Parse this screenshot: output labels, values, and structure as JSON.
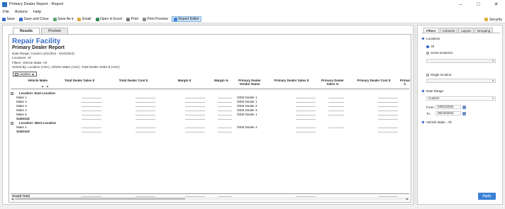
{
  "window": {
    "title": "Primary Dealer Report - Report"
  },
  "menu": [
    "File",
    "Actions",
    "Help"
  ],
  "toolbar": {
    "save": "Save",
    "save_close": "Save and Close",
    "save_as": "Save As",
    "email": "Email",
    "open_excel": "Open in Excel",
    "print": "Print",
    "print_preview": "Print Preview",
    "report_editor": "Report Editor",
    "security": "Security"
  },
  "tabs": {
    "results": "Results",
    "preview": "Preview"
  },
  "report": {
    "company": "Repair Facility",
    "title": "Primary Dealer Report",
    "date_range": "Date Range: Custom (4/1/2024 - 5/10/2024)",
    "locations": "Locations: All",
    "filters": "Filters: Vehicle Make: All",
    "sorted_by": "Sorted By: Location (ASC), Vehicle Make (ASC), Total Dealer Sales $ (ASC)",
    "group_button": "Location"
  },
  "columns": {
    "vehicle_make": "Vehicle Make",
    "total_dealer_sales": "Total Dealer Sales $",
    "total_dealer_cost": "Total Dealer Cost $",
    "margin": "Margin $",
    "margin_pct": "Margin %",
    "primary_dealer_vendor_1": "Primary Dealer",
    "primary_dealer_vendor_2": "Vendor Name",
    "primary_dealer_sales": "Primary Dealer Sales $",
    "primary_dealer_sales_pct_1": "Primary Dealer",
    "primary_dealer_sales_pct_2": "Sales %",
    "primary_dealer_cost": "Primary Dealer Cost $",
    "primary_dealer_c_1": "Primar",
    "primary_dealer_c_2": "C"
  },
  "groups": [
    {
      "label": "Location: East Location",
      "rows": [
        {
          "make": "Make 1",
          "dealer": "OEM Dealer 1"
        },
        {
          "make": "Make 2",
          "dealer": "OEM Dealer 1"
        },
        {
          "make": "Make 3",
          "dealer": "OEM Dealer 2"
        },
        {
          "make": "Make 4",
          "dealer": "OEM Dealer 3"
        },
        {
          "make": "Make 5",
          "dealer": "OEM Dealer 1"
        }
      ],
      "subtotal": "Subtotal:"
    },
    {
      "label": "Location: West Location",
      "rows": [
        {
          "make": "Make 2",
          "dealer": "OEM Dealer 4"
        }
      ],
      "subtotal": "Subtotal:"
    }
  ],
  "grand_total": "Grand Total",
  "side_panel": {
    "tabs": [
      "Filters",
      "Columns",
      "Layout",
      "Grouping"
    ],
    "locations_label": "Locations",
    "opt_all": "All",
    "opt_some": "Some locations:",
    "opt_single": "Single location:",
    "date_range_label": "Date Range",
    "date_range_value": "Custom",
    "from_label": "From:",
    "from_value": "04/01/2024",
    "to_label": "To:",
    "to_value": "05/10/2024",
    "vehicle_make": "Vehicle Make - All",
    "apply": "Apply"
  }
}
